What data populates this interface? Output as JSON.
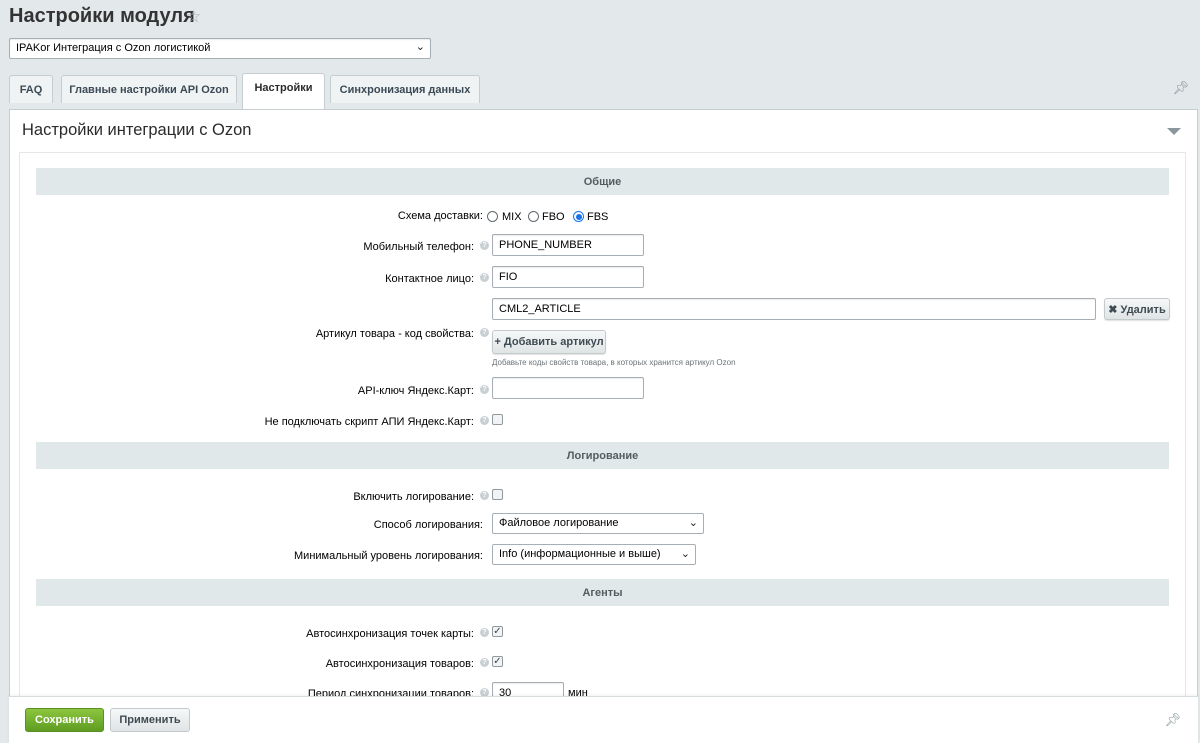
{
  "header": {
    "title": "Настройки модуля",
    "module_select": "IPAKor Интеграция с Ozon логистикой"
  },
  "tabs": [
    {
      "label": "FAQ"
    },
    {
      "label": "Главные настройки API Ozon"
    },
    {
      "label": "Настройки",
      "active": true
    },
    {
      "label": "Синхронизация данных"
    }
  ],
  "panel": {
    "title": "Настройки интеграции с Ozon"
  },
  "sections": {
    "general": "Общие",
    "logging": "Логирование",
    "agents": "Агенты"
  },
  "general": {
    "delivery_label": "Схема доставки:",
    "delivery_options": [
      "MIX",
      "FBO",
      "FBS"
    ],
    "delivery_selected": "FBS",
    "phone_label": "Мобильный телефон:",
    "phone_value": "PHONE_NUMBER",
    "contact_label": "Контактное лицо:",
    "contact_value": "FIO",
    "article_label": "Артикул товара - код свойства:",
    "article_value": "CML2_ARTICLE",
    "delete_label": "✖ Удалить",
    "add_article_label": "+ Добавить артикул",
    "article_note": "Добавьте коды свойств товара, в которых хранится артикул Ozon",
    "yandex_key_label": "API-ключ Яндекс.Карт:",
    "yandex_key_value": "",
    "no_yandex_script_label": "Не подключать скрипт АПИ Яндекс.Карт:"
  },
  "logging": {
    "enable_label": "Включить логирование:",
    "method_label": "Способ логирования:",
    "method_value": "Файловое логирование",
    "level_label": "Минимальный уровень логирования:",
    "level_value": "Info (информационные и выше)"
  },
  "agents": {
    "autosync_points_label": "Автосинхронизация точек карты:",
    "autosync_points_checked": true,
    "autosync_goods_label": "Автосинхронизация товаров:",
    "autosync_goods_checked": true,
    "period_label": "Период синхронизации товаров:",
    "period_value": "30",
    "period_unit": "мин"
  },
  "footer": {
    "save_label": "Сохранить",
    "apply_label": "Применить"
  }
}
